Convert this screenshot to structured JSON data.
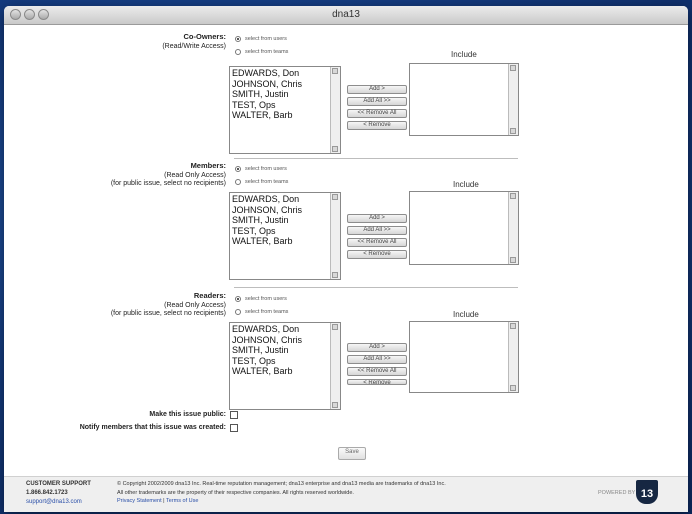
{
  "window": {
    "title": "dna13"
  },
  "sections": [
    {
      "label": "Co-Owners:",
      "sub1": "(Read/Write Access)",
      "sub2": "",
      "radio1": "select from users",
      "radio2": "select from teams",
      "include_label": "Include",
      "items": [
        "EDWARDS, Don",
        "JOHNSON, Chris",
        "SMITH, Justin",
        "TEST, Ops",
        "WALTER, Barb"
      ],
      "buttons": [
        "Add >",
        "Add All >>",
        "<< Remove All",
        "< Remove"
      ]
    },
    {
      "label": "Members:",
      "sub1": "(Read Only Access)",
      "sub2": "(for public issue, select no recipients)",
      "radio1": "select from users",
      "radio2": "select from teams",
      "include_label": "Include",
      "items": [
        "EDWARDS, Don",
        "JOHNSON, Chris",
        "SMITH, Justin",
        "TEST, Ops",
        "WALTER, Barb"
      ],
      "buttons": [
        "Add >",
        "Add All >>",
        "<< Remove All",
        "< Remove"
      ]
    },
    {
      "label": "Readers:",
      "sub1": "(Read Only Access)",
      "sub2": "(for public issue, select no recipients)",
      "radio1": "select from users",
      "radio2": "select from teams",
      "include_label": "Include",
      "items": [
        "EDWARDS, Don",
        "JOHNSON, Chris",
        "SMITH, Justin",
        "TEST, Ops",
        "WALTER, Barb"
      ],
      "buttons": [
        "Add >",
        "Add All >>",
        "<< Remove All",
        "< Remove"
      ]
    }
  ],
  "options": {
    "make_public": "Make this issue public:",
    "notify": "Notify members that this issue was created:"
  },
  "submit_label": "Save",
  "footer": {
    "support_title": "CUSTOMER SUPPORT",
    "phone": "1.866.842.1723",
    "email": "support@dna13.com",
    "copyright": "© Copyright 2002/2009 dna13 Inc. Real-time reputation management; dna13 enterprise and dna13 media are trademarks of dna13 Inc.",
    "trademarks": "All other trademarks are the property of their respective companies. All rights reserved worldwide.",
    "privacy": "Privacy Statement",
    "sep": "|",
    "terms": "Terms of Use",
    "powered": "POWERED BY",
    "logo_text": "13"
  }
}
